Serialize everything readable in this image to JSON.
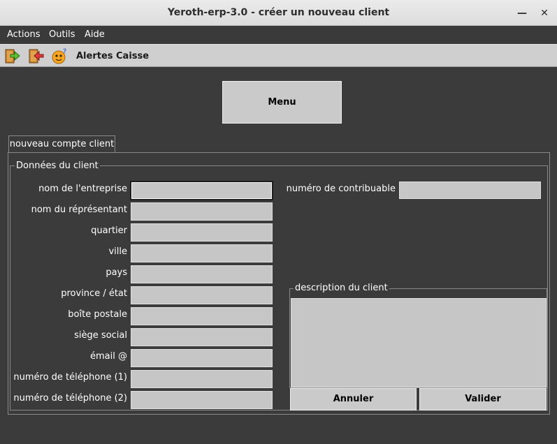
{
  "window": {
    "title": "Yeroth-erp-3.0 - créer un nouveau client",
    "minimize_glyph": "—",
    "close_glyph": "✕"
  },
  "menubar": {
    "items": [
      "Actions",
      "Outils",
      "Aide"
    ]
  },
  "toolbar": {
    "icons": [
      "door-enter-green-arrow-icon",
      "door-exit-red-arrow-icon",
      "smiley-help-icon"
    ],
    "alertes_label": "Alertes",
    "caisse_label": "Caisse"
  },
  "menu_button_label": "Menu",
  "tab_label": "nouveau compte client",
  "group_title": "Données du client",
  "fields": {
    "entreprise": {
      "label": "nom de l'entreprise",
      "value": ""
    },
    "representant": {
      "label": "nom du réprésentant",
      "value": ""
    },
    "quartier": {
      "label": "quartier",
      "value": ""
    },
    "ville": {
      "label": "ville",
      "value": ""
    },
    "pays": {
      "label": "pays",
      "value": ""
    },
    "province": {
      "label": "province / état",
      "value": ""
    },
    "boite_postale": {
      "label": "boîte postale",
      "value": ""
    },
    "siege_social": {
      "label": "siège social",
      "value": ""
    },
    "email": {
      "label": "émail @",
      "value": ""
    },
    "telephone1": {
      "label": "numéro de téléphone (1)",
      "value": ""
    },
    "telephone2": {
      "label": "numéro de téléphone (2)",
      "value": ""
    },
    "contribuable": {
      "label": "numéro de contribuable",
      "value": ""
    }
  },
  "description": {
    "title": "description du client",
    "value": ""
  },
  "buttons": {
    "annuler": "Annuler",
    "valider": "Valider"
  },
  "colors": {
    "window_bg": "#3b3b3b",
    "field_bg": "#c6c6c6",
    "toolbar_bg": "#cfcfcf"
  }
}
